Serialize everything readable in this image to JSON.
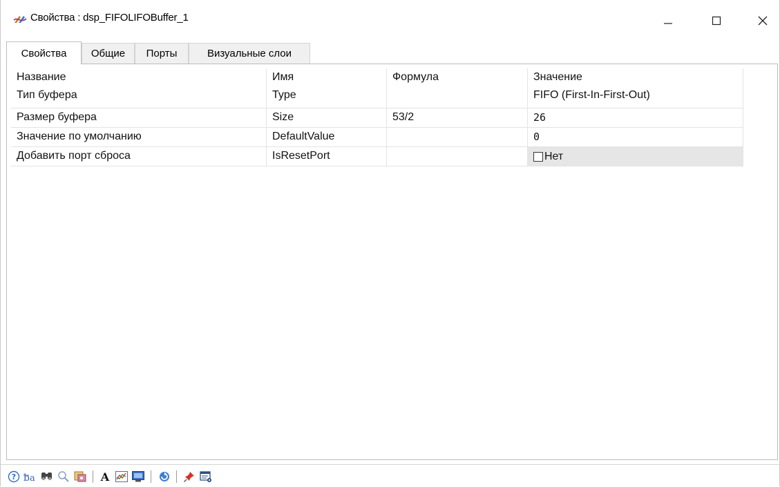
{
  "window": {
    "title": "Свойства : dsp_FIFOLIFOBuffer_1"
  },
  "tabs": [
    {
      "label": "Свойства",
      "active": true
    },
    {
      "label": "Общие",
      "active": false
    },
    {
      "label": "Порты",
      "active": false
    },
    {
      "label": "Визуальные слои",
      "active": false
    }
  ],
  "table": {
    "headers": {
      "name": "Название",
      "id": "Имя",
      "formula": "Формула",
      "value": "Значение"
    },
    "rows": [
      {
        "name": "Тип буфера",
        "id": "Type",
        "formula": "",
        "value": "FIFO (First-In-First-Out)"
      },
      {
        "name": "Размер буфера",
        "id": "Size",
        "formula": "53/2",
        "value": "26"
      },
      {
        "name": "Значение по умолчанию",
        "id": "DefaultValue",
        "formula": "",
        "value": "0"
      },
      {
        "name": "Добавить порт сброса",
        "id": "IsResetPort",
        "formula": "",
        "value": "Нет",
        "checked": false
      }
    ]
  },
  "toolbar": {
    "icons": [
      "help-icon",
      "rename-icon",
      "find-icon",
      "zoom-icon",
      "palette-icon",
      "font-icon",
      "chart-icon",
      "monitor-icon",
      "refresh-icon",
      "pin-icon",
      "window-settings-icon"
    ]
  }
}
